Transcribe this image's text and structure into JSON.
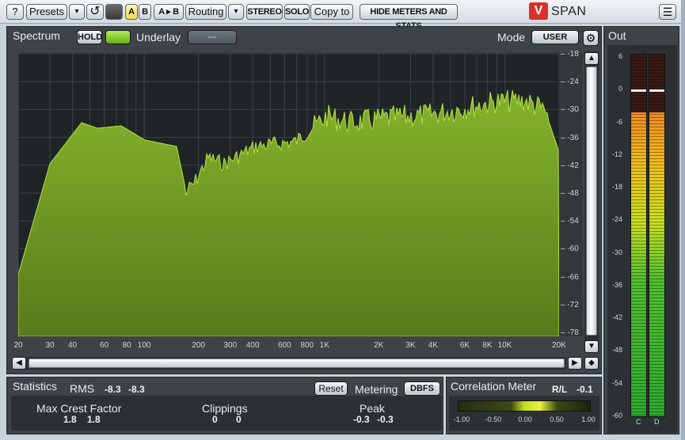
{
  "toolbar": {
    "help": "?",
    "presets": "Presets",
    "presets_dropdown": "▾",
    "undo": "↺",
    "a": "A",
    "b": "B",
    "a_to_b": "A ▸ B",
    "routing": "Routing",
    "routing_dropdown": "▾",
    "stereo": "STEREO",
    "solo": "SOLO",
    "copy_to": "Copy to",
    "hide_meters": "HIDE METERS AND STATS",
    "logo": "V",
    "brand": "SPAN",
    "menu": "☰"
  },
  "spectrum": {
    "title": "Spectrum",
    "hold": "HOLD",
    "underlay_label": "Underlay",
    "underlay_value": "---",
    "mode_label": "Mode",
    "mode_value": "USER",
    "gear": "⚙",
    "fill_color": "#7aa82a",
    "db_ticks": [
      "-18",
      "-24",
      "-30",
      "-36",
      "-42",
      "-48",
      "-54",
      "-60",
      "-66",
      "-72",
      "-78"
    ],
    "freq_ticks": [
      "20",
      "30",
      "40",
      "60",
      "80",
      "100",
      "200",
      "300",
      "400",
      "600",
      "800",
      "1K",
      "2K",
      "3K",
      "4K",
      "6K",
      "8K",
      "10K",
      "20K"
    ],
    "scroll_up": "▲",
    "scroll_down": "▼",
    "scroll_left": "◀",
    "scroll_right": "▶",
    "reset_zoom": "◆"
  },
  "statistics": {
    "title": "Statistics",
    "rms_label": "RMS",
    "rms_l": "-8.3",
    "rms_r": "-8.3",
    "reset": "Reset",
    "metering_label": "Metering",
    "metering_value": "DBFS",
    "crest_label": "Max Crest Factor",
    "crest_l": "1.8",
    "crest_r": "1.8",
    "clip_label": "Clippings",
    "clip_l": "0",
    "clip_r": "0",
    "peak_label": "Peak",
    "peak_l": "-0.3",
    "peak_r": "-0.3"
  },
  "correlation": {
    "title": "Correlation Meter",
    "rl_label": "R/L",
    "rl_value": "-0.1",
    "ticks": [
      "-1.00",
      "-0.50",
      "0.00",
      "0.50",
      "1.00"
    ]
  },
  "out": {
    "title": "Out",
    "ticks": [
      "6",
      "0",
      "-6",
      "-12",
      "-18",
      "-24",
      "-30",
      "-36",
      "-42",
      "-48",
      "-54",
      "-60"
    ],
    "channel_c": "C",
    "channel_d": "D",
    "level_c": 0.84,
    "level_d": 0.84
  }
}
